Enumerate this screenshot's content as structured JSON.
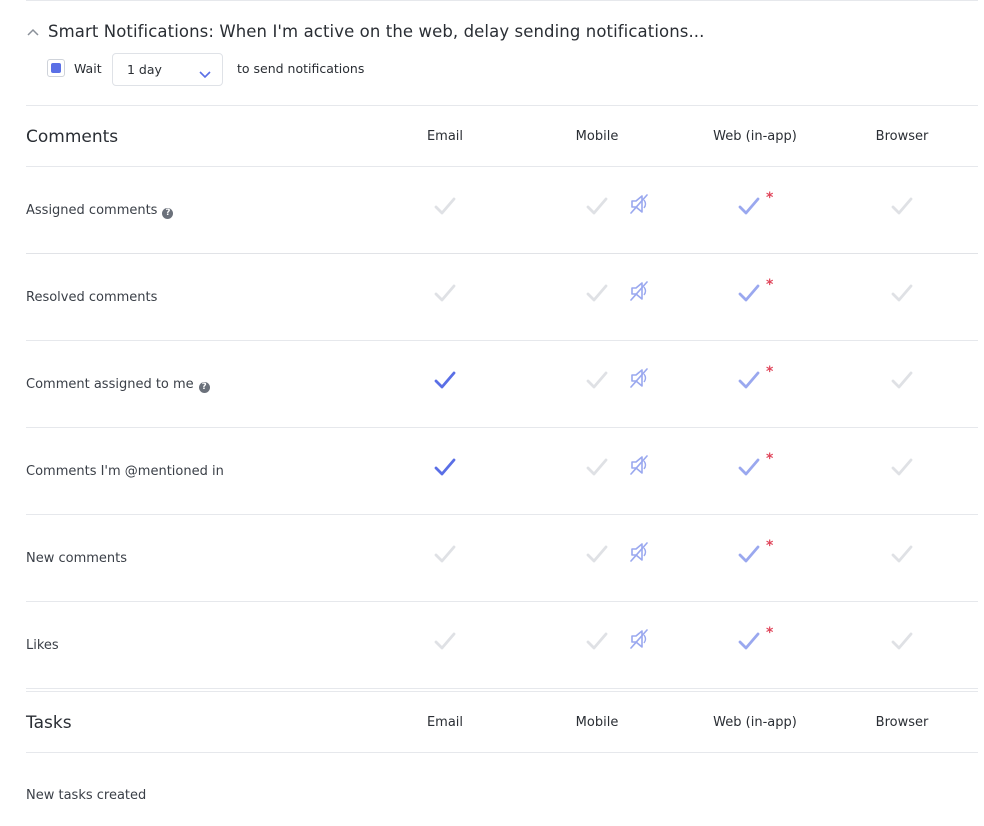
{
  "smart": {
    "title": "Smart Notifications: When I'm active on the web, delay sending notifications...",
    "wait_label": "Wait",
    "delay_value": "1 day",
    "after_label": "to send notifications",
    "wait_checked": true
  },
  "colors": {
    "accent": "#5a6fe6",
    "check_on": "#5a6fe6",
    "check_light": "#9aa8ef",
    "check_off": "#dfe1e5",
    "required_star": "#e0455a",
    "divider": "#e6e8ec"
  },
  "columns": [
    "Email",
    "Mobile",
    "Web (in-app)",
    "Browser"
  ],
  "comments": {
    "title": "Comments",
    "rows": [
      {
        "label": "Assigned comments",
        "help": true,
        "email": false,
        "mobile": false,
        "mobile_muted": true,
        "web": true,
        "browser": false
      },
      {
        "label": "Resolved comments",
        "help": false,
        "email": false,
        "mobile": false,
        "mobile_muted": true,
        "web": true,
        "browser": false
      },
      {
        "label": "Comment assigned to me",
        "help": true,
        "email": true,
        "mobile": false,
        "mobile_muted": true,
        "web": true,
        "browser": false
      },
      {
        "label": "Comments I'm @mentioned in",
        "help": false,
        "email": true,
        "mobile": false,
        "mobile_muted": true,
        "web": true,
        "browser": false
      },
      {
        "label": "New comments",
        "help": false,
        "email": false,
        "mobile": false,
        "mobile_muted": true,
        "web": true,
        "browser": false
      },
      {
        "label": "Likes",
        "help": false,
        "email": false,
        "mobile": false,
        "mobile_muted": true,
        "web": true,
        "browser": false
      }
    ]
  },
  "tasks": {
    "title": "Tasks",
    "rows": [
      {
        "label": "New tasks created"
      }
    ]
  },
  "icons": {
    "collapse": "chevron-up-icon",
    "dropdown": "chevron-down-icon",
    "check": "check-icon",
    "muted": "muted-speaker-icon",
    "help": "question-circle-icon",
    "required": "asterisk-icon"
  },
  "glyphs": {
    "help": "?",
    "required": "*"
  }
}
